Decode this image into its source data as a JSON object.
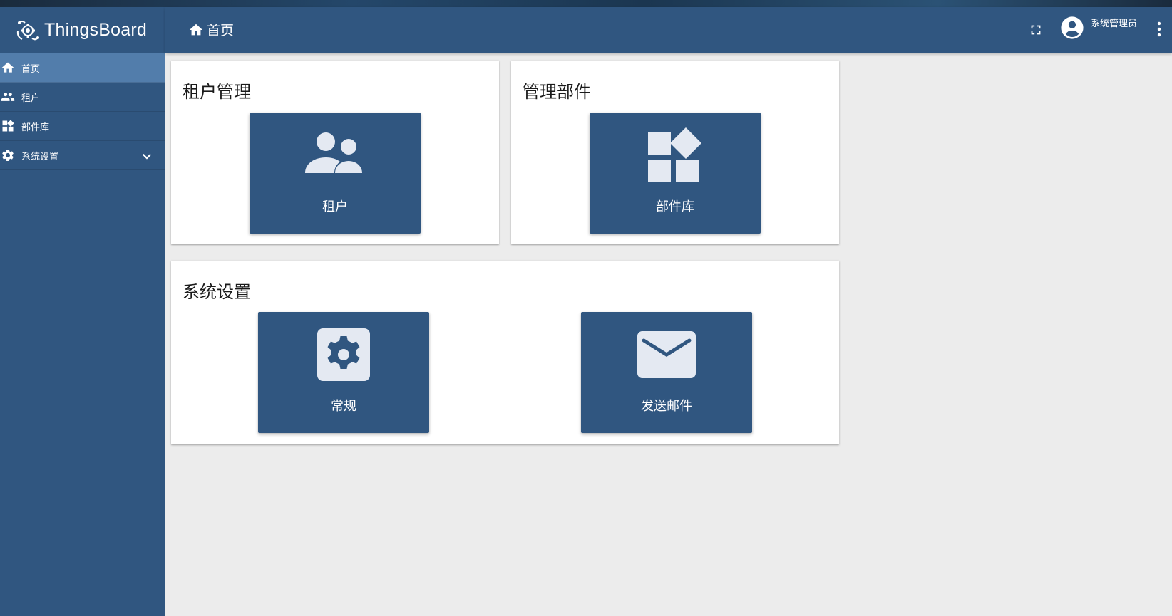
{
  "app": {
    "name": "ThingsBoard"
  },
  "colors": {
    "primary": "#305680",
    "sidebar_active": "#527dab",
    "background": "#ececec",
    "icon_fill": "#e4e9f2"
  },
  "sidebar": {
    "items": [
      {
        "label": "首页",
        "icon": "home-icon",
        "active": true
      },
      {
        "label": "租户",
        "icon": "people-icon"
      },
      {
        "label": "部件库",
        "icon": "widgets-icon"
      },
      {
        "label": "系统设置",
        "icon": "gear-icon",
        "expandable": true
      }
    ]
  },
  "header": {
    "breadcrumb": "首页",
    "user_name": "系统管理员",
    "icons": [
      "fullscreen-icon",
      "account-circle-icon",
      "more-vert-icon"
    ]
  },
  "cards": [
    {
      "title": "租户管理",
      "tiles": [
        {
          "label": "租户",
          "icon": "people-icon"
        }
      ]
    },
    {
      "title": "管理部件",
      "tiles": [
        {
          "label": "部件库",
          "icon": "widgets-icon"
        }
      ]
    },
    {
      "title": "系统设置",
      "tiles": [
        {
          "label": "常规",
          "icon": "gear-icon"
        },
        {
          "label": "发送邮件",
          "icon": "mail-icon"
        }
      ]
    }
  ]
}
